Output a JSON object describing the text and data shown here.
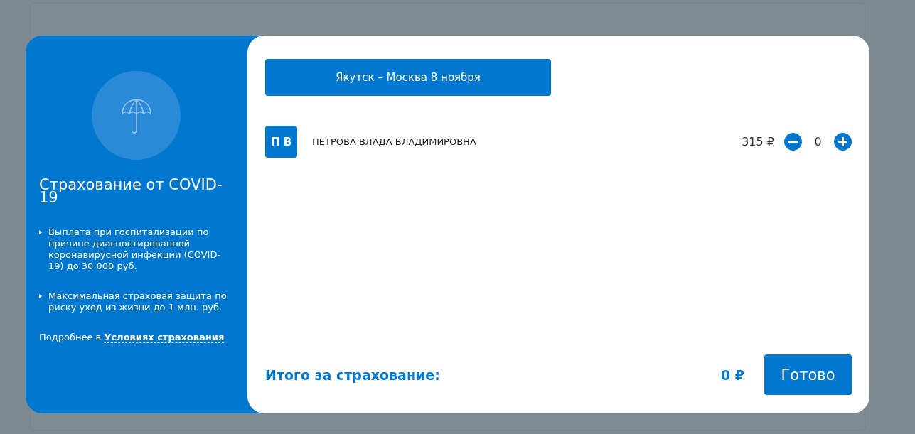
{
  "info": {
    "title": "Страхование от COVID-19",
    "bullets": [
      "Выплата при госпитализации по причине диагностированной коронавирусной инфекции (COVID-19) до 30 000 руб.",
      "Максимальная страховая защита по риску уход из жизни до 1 млн. руб."
    ],
    "more_text": "Подробнее в",
    "more_link": "Условиях страхования"
  },
  "flight": {
    "label": "Якутск – Москва 8 ноября"
  },
  "passengers": [
    {
      "initials": "П В",
      "name": "ПЕТРОВА ВЛАДА ВЛАДИМИРОВНА",
      "price": "315 ₽",
      "count": "0"
    }
  ],
  "total": {
    "label": "Итого за страхование:",
    "amount": "0 ₽"
  },
  "done_button": "Готово"
}
